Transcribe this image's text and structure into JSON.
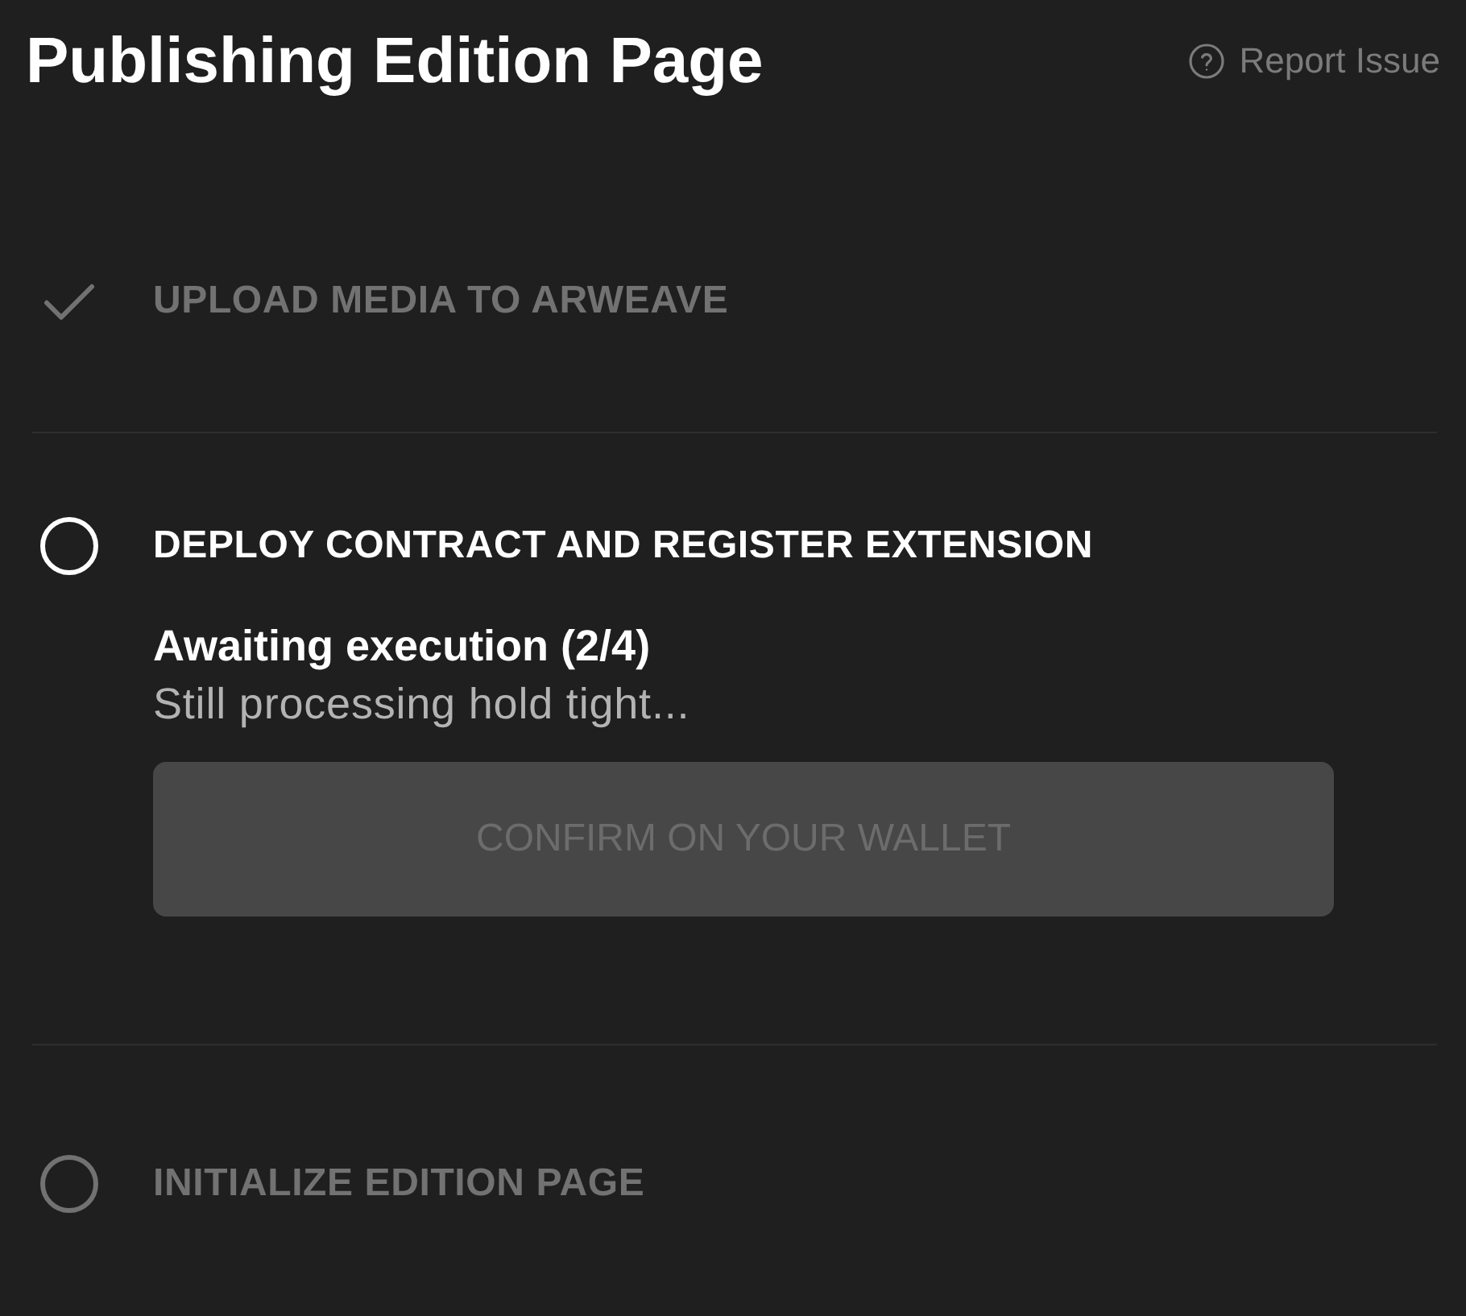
{
  "header": {
    "title": "Publishing Edition Page",
    "report_link": {
      "label": "Report Issue"
    }
  },
  "steps": [
    {
      "label": "UPLOAD MEDIA TO ARWEAVE",
      "completed": true,
      "active": false
    },
    {
      "label": "DEPLOY CONTRACT AND REGISTER EXTENSION",
      "completed": false,
      "active": true,
      "details": {
        "heading": "Awaiting execution (2/4)",
        "message": "Still processing hold tight...",
        "button": {
          "label": "CONFIRM ON YOUR WALLET",
          "disabled": true
        }
      }
    },
    {
      "label": "INITIALIZE EDITION PAGE",
      "completed": false,
      "active": false
    }
  ]
}
